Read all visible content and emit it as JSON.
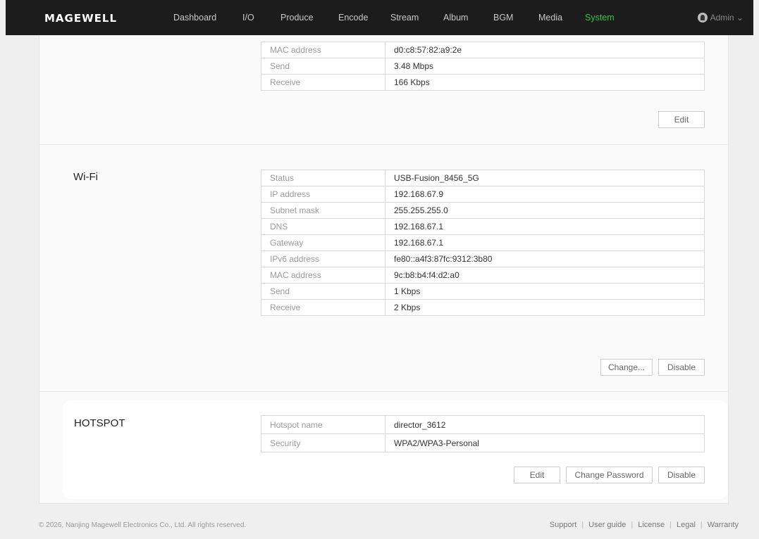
{
  "header": {
    "logo": "MAGEWELL",
    "nav": [
      "Dashboard",
      "I/O",
      "Produce",
      "Encode",
      "Stream",
      "Album",
      "BGM",
      "Media",
      "System"
    ],
    "active": "System",
    "user": "Admin"
  },
  "ethernet": {
    "rows": [
      {
        "key": "MAC address",
        "value": "d0:c8:57:82:a9:2e"
      },
      {
        "key": "Send",
        "value": "3.48 Mbps"
      },
      {
        "key": "Receive",
        "value": "166 Kbps"
      }
    ],
    "edit_label": "Edit"
  },
  "wifi": {
    "title": "Wi-Fi",
    "rows": [
      {
        "key": "Status",
        "value": "USB-Fusion_8456_5G"
      },
      {
        "key": "IP address",
        "value": "192.168.67.9"
      },
      {
        "key": "Subnet mask",
        "value": "255.255.255.0"
      },
      {
        "key": "DNS",
        "value": "192.168.67.1"
      },
      {
        "key": "Gateway",
        "value": "192.168.67.1"
      },
      {
        "key": "IPv6 address",
        "value": "fe80::a4f3:87fc:9312:3b80"
      },
      {
        "key": "MAC address",
        "value": "9c:b8:b4:f4:d2:a0"
      },
      {
        "key": "Send",
        "value": "1 Kbps"
      },
      {
        "key": "Receive",
        "value": "2 Kbps"
      }
    ],
    "change_label": "Change...",
    "disable_label": "Disable"
  },
  "hotspot": {
    "title": "HOTSPOT",
    "rows": [
      {
        "key": "Hotspot name",
        "value": "director_3612"
      },
      {
        "key": "Security",
        "value": "WPA2/WPA3-Personal"
      }
    ],
    "edit_label": "Edit",
    "change_password_label": "Change Password",
    "disable_label": "Disable"
  },
  "footer": {
    "copyright": "© 2026, Nanjing Magewell Electronics Co., Ltd. All rights reserved.",
    "links": [
      "Support",
      "User guide",
      "License",
      "Legal",
      "Warranty"
    ]
  }
}
